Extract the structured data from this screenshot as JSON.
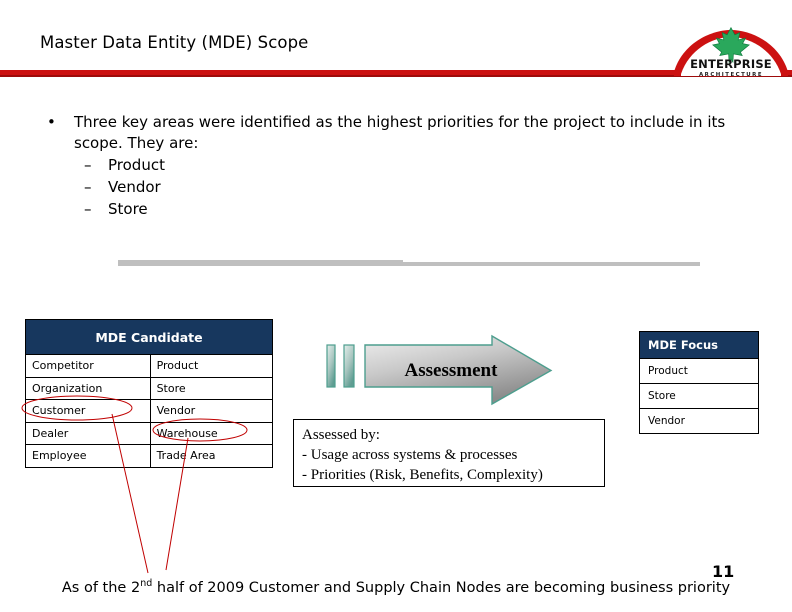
{
  "slide": {
    "title": "Master Data Entity (MDE) Scope",
    "page_number": "11",
    "accent_red": "#cc1111",
    "table_header_blue": "#17375e",
    "annotation_red": "#c00000",
    "divider_gray": "#bfbfbf"
  },
  "logo": {
    "name_line1": "ENTERPRISE",
    "name_line2": "ARCHITECTURE",
    "leaf_color": "#1e9b4e",
    "arc_color": "#cc1111"
  },
  "body": {
    "bullet_mark": "•",
    "bullet_text": "Three key areas were identified as the highest priorities for the project to include in its scope. They are:",
    "sub_mark": "–",
    "sub_items": [
      "Product",
      "Vendor",
      "Store"
    ]
  },
  "mde_candidate": {
    "header": "MDE Candidate",
    "rows": [
      [
        "Competitor",
        "Product"
      ],
      [
        "Organization",
        "Store"
      ],
      [
        "Customer",
        "Vendor"
      ],
      [
        "Dealer",
        "Warehouse"
      ],
      [
        "Employee",
        "Trade Area"
      ]
    ]
  },
  "mde_focus": {
    "header": "MDE Focus",
    "rows": [
      "Product",
      "Store",
      "Vendor"
    ]
  },
  "assessment": {
    "arrow_label": "Assessment",
    "arrow_fill_light": "#e8e8e8",
    "arrow_fill_dark": "#9a9a9a",
    "arrow_border": "#4d9e8e"
  },
  "assessed_box": {
    "title": "Assessed by:",
    "line1": "- Usage across systems & processes",
    "line2": "- Priorities (Risk, Benefits, Complexity)"
  },
  "footer": {
    "prefix": "As of the 2",
    "ordinal": "nd",
    "suffix": " half of 2009 Customer and Supply Chain Nodes are becoming business priority"
  }
}
